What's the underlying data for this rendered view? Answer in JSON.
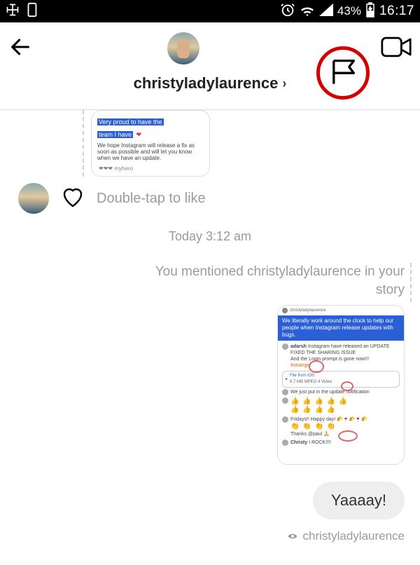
{
  "status": {
    "battery_pct": "43%",
    "time": "16:17"
  },
  "header": {
    "username": "christyladylaurence",
    "chevron": "›"
  },
  "story1": {
    "line1": "Very proud to have the",
    "line2": "team I have",
    "caption": "We hope Instagram will release a fix as soon as possible and will let you know when we have an update.",
    "footer": "❤❤❤ myhero"
  },
  "like_hint": "Double-tap to like",
  "timestamp": "Today 3:12 am",
  "mention_label": "You mentioned christyladylaurence in your story",
  "story2": {
    "bluehead": "We literally work around the clock to help our people when Instagram release updates with bugs.",
    "row1_name": "adarsh",
    "row1_text": "Instagram have released an UPDATE FIXED THE SHARING ISSUE",
    "row1_text2": "And the Login prompt is gone now!!!",
    "row1_tag": "#strange",
    "file_name": "File from iOS",
    "file_meta": "6.7 MB MPEG 4 Video",
    "row2_text": "We just put in the update notification",
    "emoji1": "👍 👍 👍 👍 👍",
    "emoji2": "👍 👍 👍 👍",
    "row3_text": "Fridays!! Happy day! 🌮🍷🌮🍷🌮",
    "emoji3": "👏 👏 👏 👏",
    "row4_text": "Thanks @paul 🙏",
    "row5_name": "Christy",
    "row5_text": "I ROCK!!!!"
  },
  "bubble": "Yaaaay!",
  "seen_by": "christyladylaurence"
}
